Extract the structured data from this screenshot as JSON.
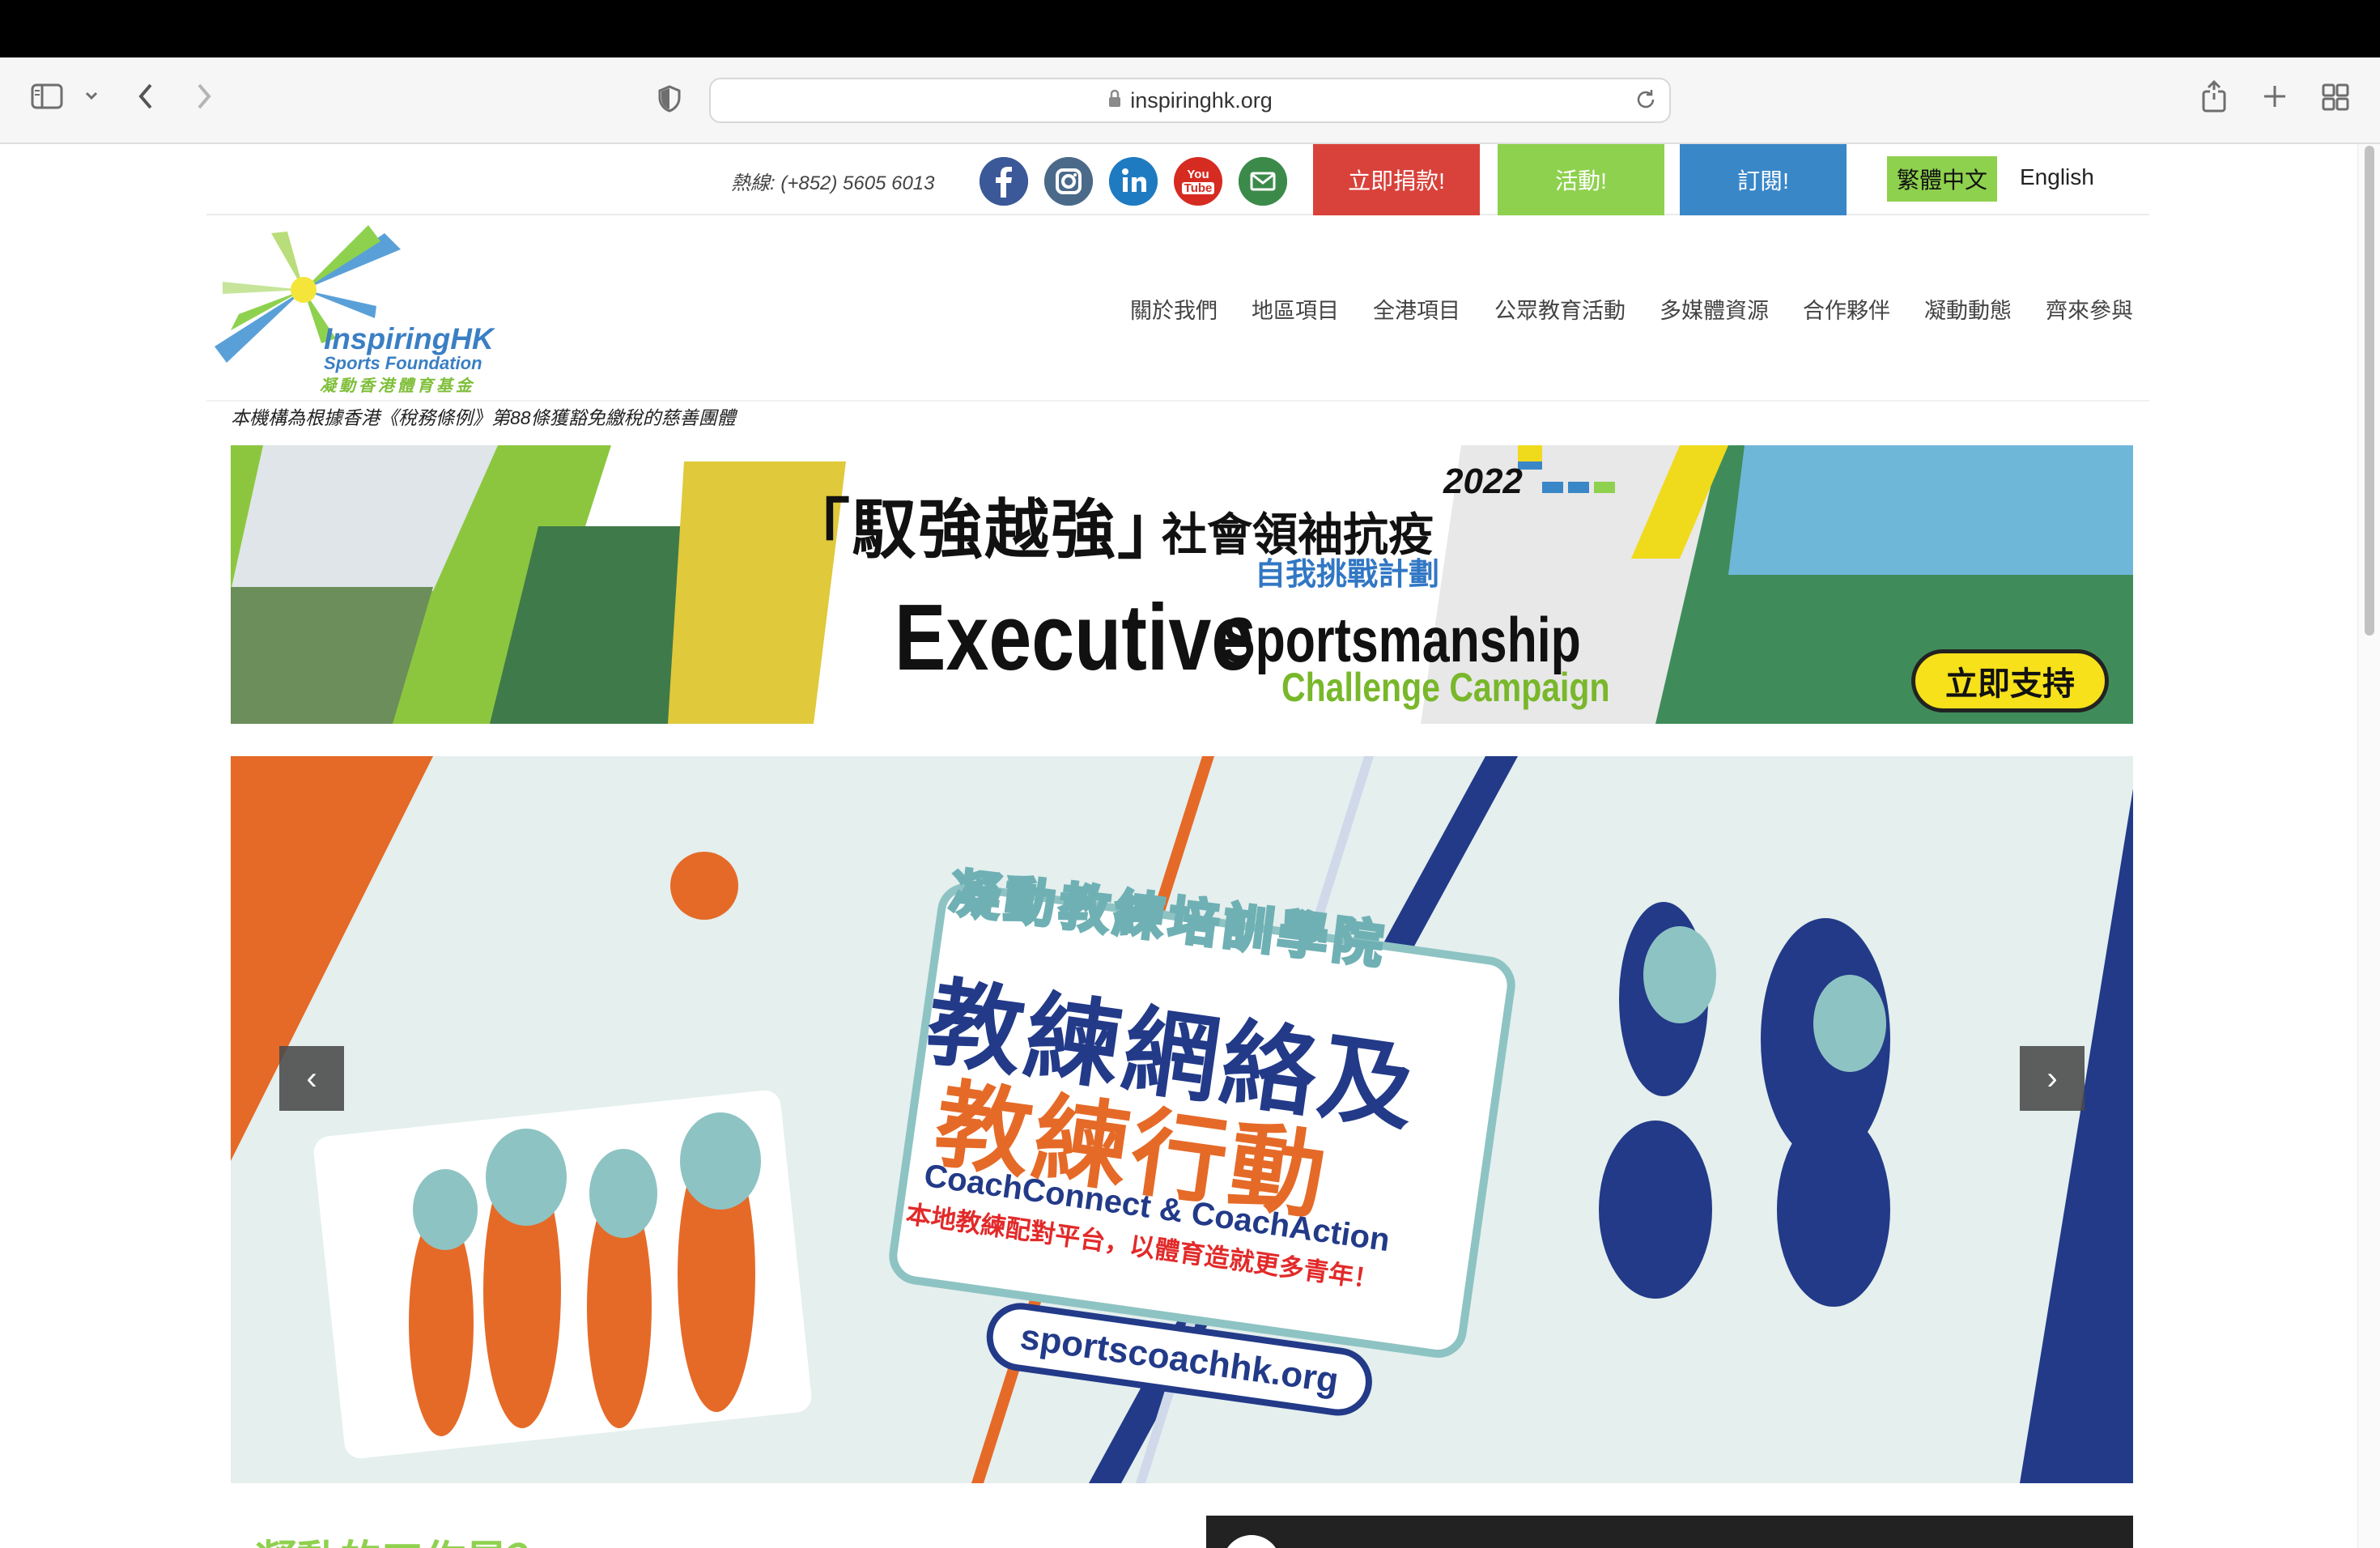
{
  "browser": {
    "url": "inspiringhk.org"
  },
  "utility": {
    "hotline": "熱線: (+852) 5605 6013",
    "donate_label": "立即捐款!",
    "events_label": "活動!",
    "subscribe_label": "訂閱!",
    "lang_zh": "繁體中文",
    "lang_en": "English",
    "social": {
      "youtube_line1": "You",
      "youtube_line2": "Tube"
    },
    "colors": {
      "donate": "#d9423b",
      "events": "#8ed14e",
      "subscribe": "#3a87c8",
      "facebook": "#3b5998",
      "instagram": "#4b6a89",
      "linkedin": "#1f7bc1",
      "youtube": "#d62b21",
      "email": "#3c8a4a"
    }
  },
  "logo": {
    "name": "InspiringHK",
    "sub": "Sports Foundation",
    "cn": "凝動香港體育基金"
  },
  "nav": {
    "items": [
      "關於我們",
      "地區項目",
      "全港項目",
      "公眾教育活動",
      "多媒體資源",
      "合作夥伴",
      "凝動動態",
      "齊來參與"
    ]
  },
  "charity_note": "本機構為根據香港《稅務條例》第88條獲豁免繳稅的慈善團體",
  "banner1": {
    "year": "2022",
    "title_cn": "「馭強越強」",
    "title_cn2": "社會領袖抗疫",
    "subtitle_cn": "自我挑戰計劃",
    "title_en1": "Executive",
    "title_en2": "Sportsmanship",
    "title_en3": "Challenge Campaign",
    "cta": "立即支持"
  },
  "banner2": {
    "academy": "凝動教練培訓學院",
    "big1": "教練網絡及",
    "big2": "教練行動",
    "coach_en": "CoachConnect & CoachAction",
    "match_cn": "本地教練配對平台，以體育造就更多青年！",
    "url": "sportscoachhk.org",
    "prev": "‹",
    "next": "›"
  },
  "bottom": {
    "partial_title": "凝動的工作是？"
  }
}
